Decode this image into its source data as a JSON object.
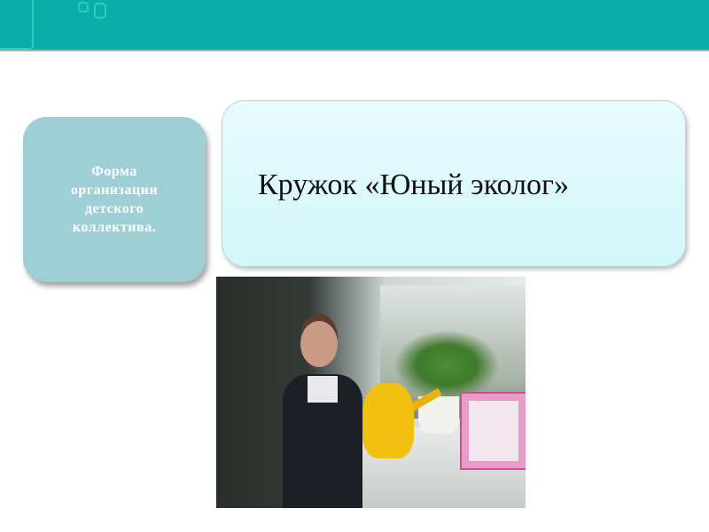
{
  "slide": {
    "left_box_text": "Форма организации детского коллектива.",
    "title_box_text": "Кружок «Юный эколог»",
    "photo_icon": "photo-girl-watering-plant"
  },
  "colors": {
    "header": "#0eaca9",
    "left_box": "#9dcfd4",
    "title_box": "#dff9fc"
  }
}
